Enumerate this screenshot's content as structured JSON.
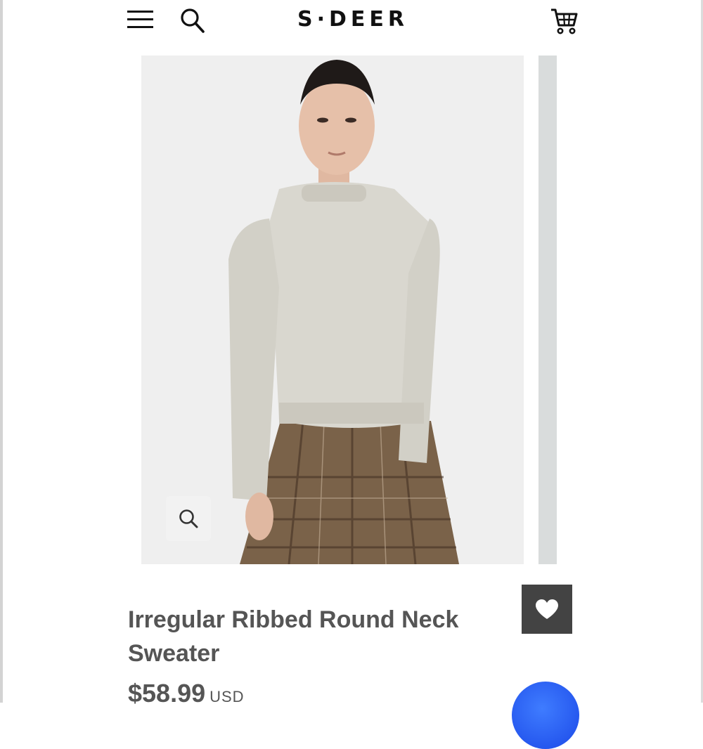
{
  "header": {
    "brand": "S·DEER",
    "icons": {
      "menu": "hamburger-icon",
      "search": "search-icon",
      "cart": "cart-icon"
    }
  },
  "gallery": {
    "image_alt": "Model wearing a speckled oatmeal knit sweater with a brown plaid skirt",
    "zoom_icon": "zoom-icon"
  },
  "product": {
    "title": "Irregular Ribbed Round Neck Sweater",
    "price": "$58.99",
    "currency": "USD"
  },
  "colors": {
    "text_gray": "#555555",
    "wishlist_bg": "#434343",
    "chat_blue": "#2a5cf0"
  }
}
